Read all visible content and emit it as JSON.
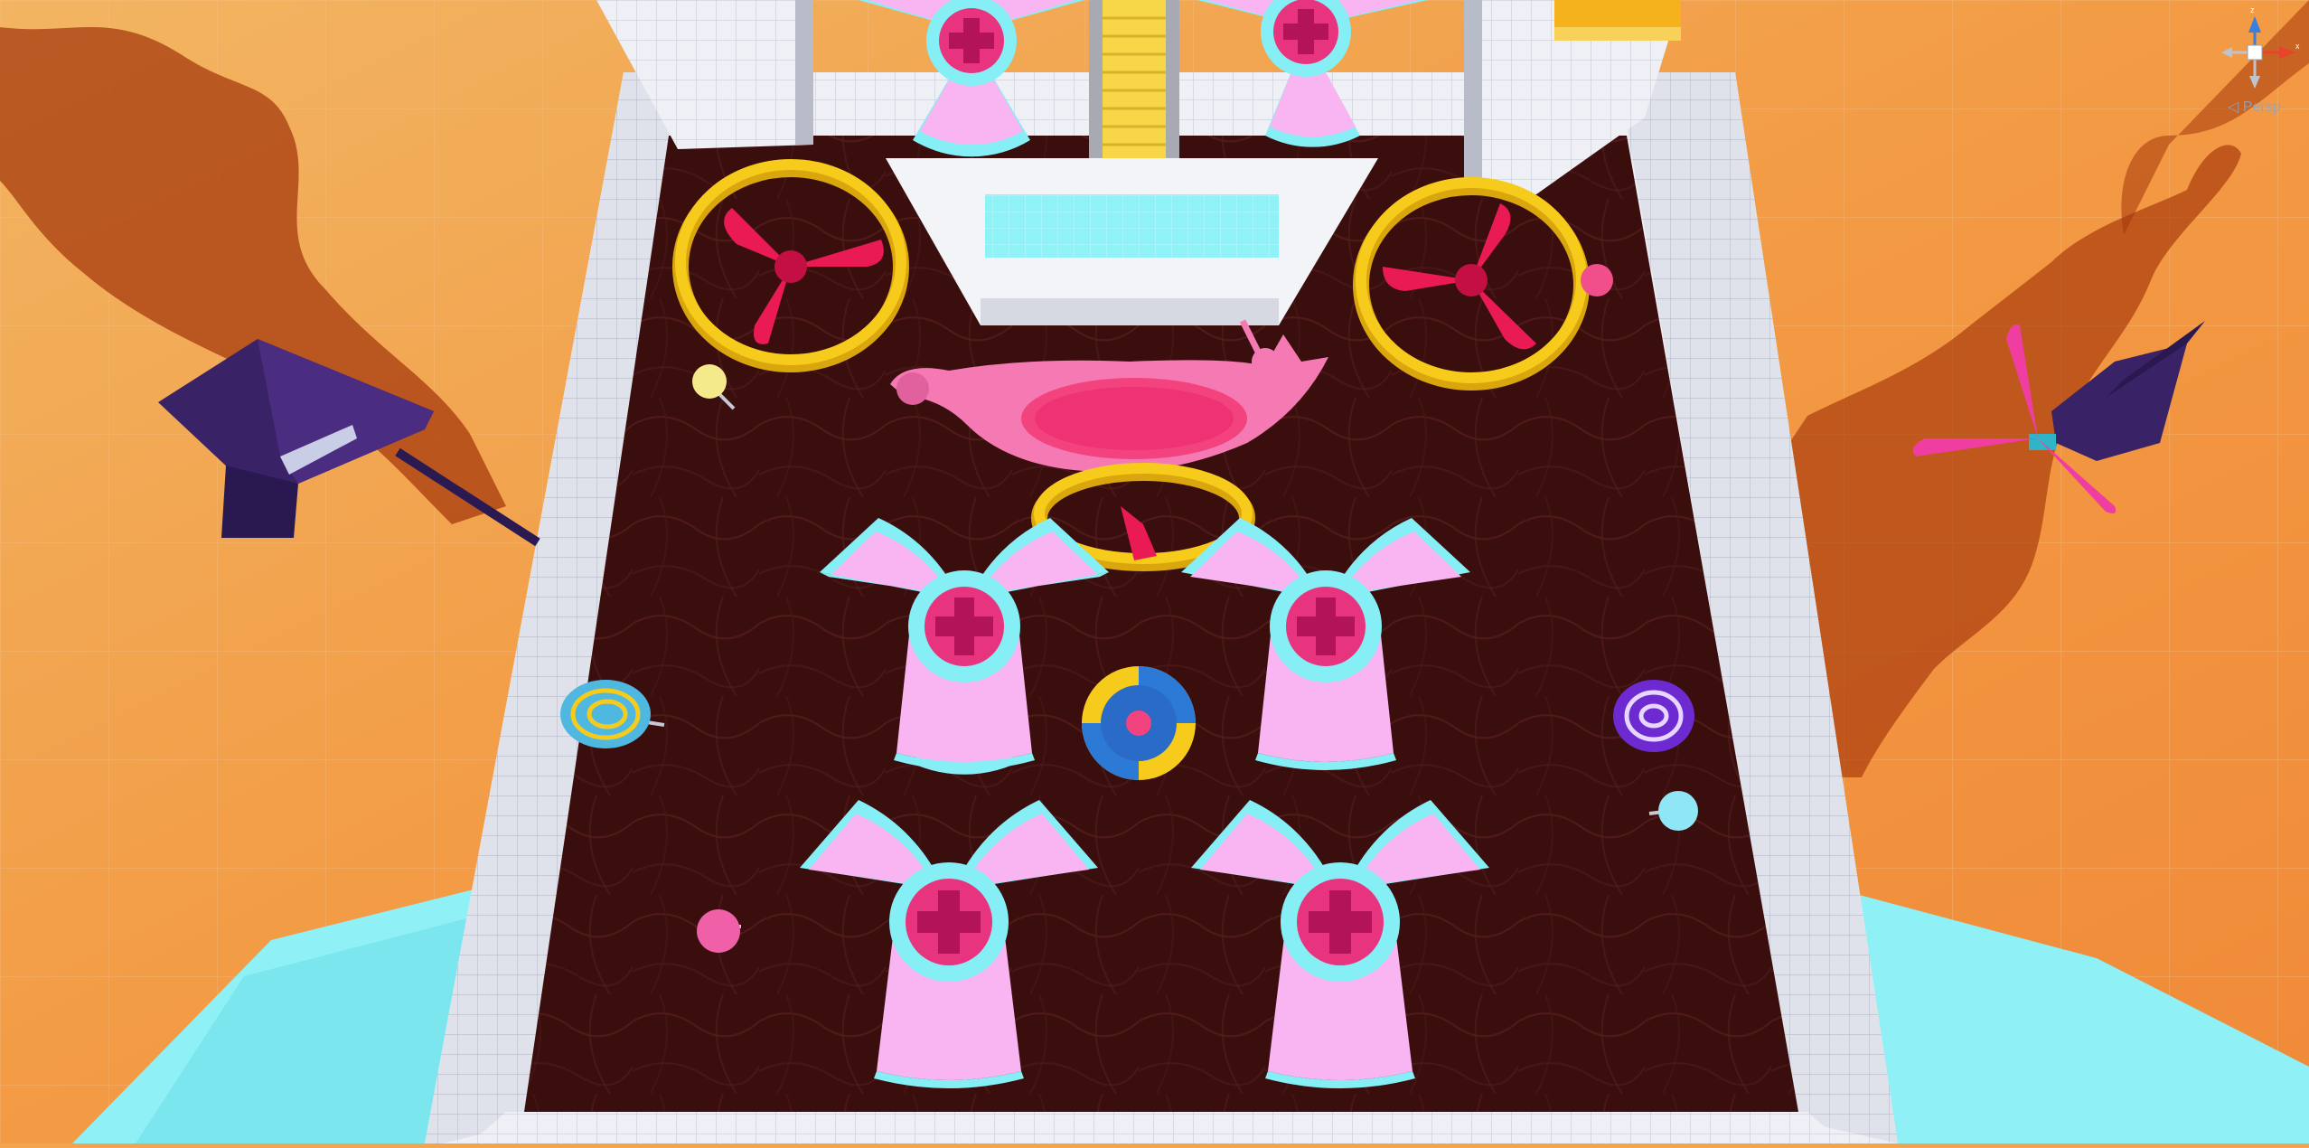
{
  "scene_view": {
    "projection_label": "◁ Persp",
    "gizmo": {
      "axis_y_label": "y",
      "axis_x_label": "x",
      "axis_z_label": "z",
      "axis_x_color": "#e8432b",
      "axis_y_color": "#8ecb3c",
      "axis_z_color": "#3a7fe0"
    }
  },
  "colors": {
    "sky_orange": "#f3a54e",
    "board_floor": "#3a0f0f",
    "wall_white": "#eef0f5",
    "fan_pink": "#f9b4f2",
    "fan_rim": "#86eef5",
    "hub_magenta": "#e8347e",
    "ring_yellow": "#f6cb1b",
    "propeller_red": "#ea1a55",
    "dark_purple": "#36205e"
  }
}
